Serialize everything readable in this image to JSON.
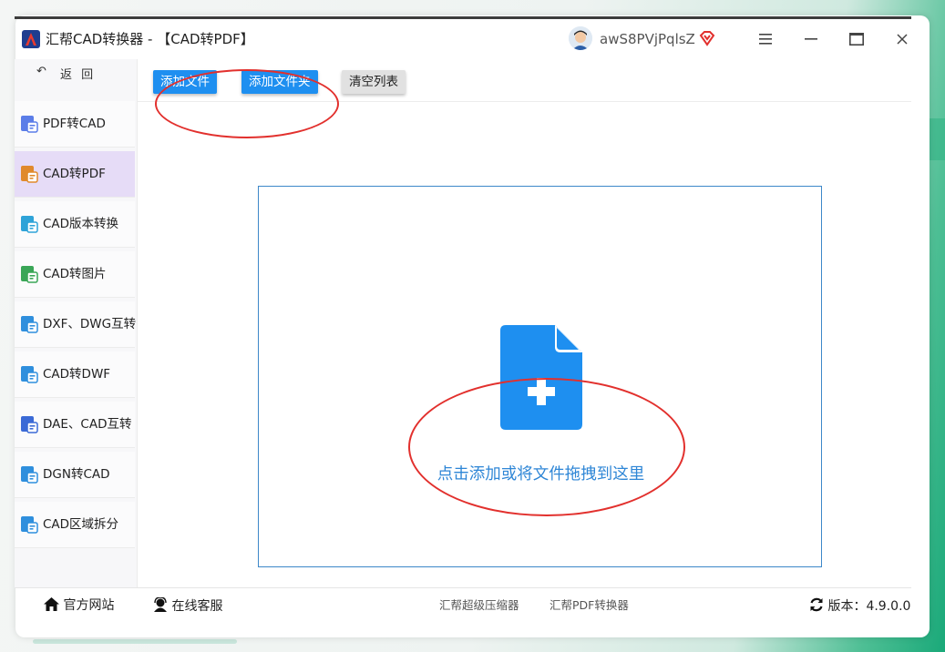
{
  "window": {
    "title": "汇帮CAD转换器 - 【CAD转PDF】",
    "username": "awS8PVjPqlsZ",
    "controls": [
      "menu-icon",
      "minimize-icon",
      "maximize-icon",
      "close-icon"
    ]
  },
  "sidebar": {
    "back_label": "返 回",
    "active_index": 1,
    "items": [
      {
        "label": "PDF转CAD",
        "icon": "pdf-to-cad-icon"
      },
      {
        "label": "CAD转PDF",
        "icon": "cad-to-pdf-icon"
      },
      {
        "label": "CAD版本转换",
        "icon": "cad-version-icon"
      },
      {
        "label": "CAD转图片",
        "icon": "cad-to-image-icon"
      },
      {
        "label": "DXF、DWG互转",
        "icon": "dxf-dwg-icon"
      },
      {
        "label": "CAD转DWF",
        "icon": "cad-to-dwf-icon"
      },
      {
        "label": "DAE、CAD互转",
        "icon": "dae-cad-icon"
      },
      {
        "label": "DGN转CAD",
        "icon": "dgn-to-cad-icon"
      },
      {
        "label": "CAD区域拆分",
        "icon": "cad-split-icon"
      }
    ]
  },
  "toolbar": {
    "add_file": "添加文件",
    "add_folder": "添加文件夹",
    "clear_list": "清空列表"
  },
  "drop_zone": {
    "hint": "点击添加或将文件拖拽到这里",
    "icon": "add-file-icon"
  },
  "footer": {
    "website": "官方网站",
    "support": "在线客服",
    "link1": "汇帮超级压缩器",
    "link2": "汇帮PDF转换器",
    "version": "版本：4.9.0.0"
  },
  "colors": {
    "accent": "#1e8ff0",
    "active_nav": "#e6dcf7",
    "annotation_ring": "#e2302d",
    "hint_text": "#2e86d6"
  }
}
